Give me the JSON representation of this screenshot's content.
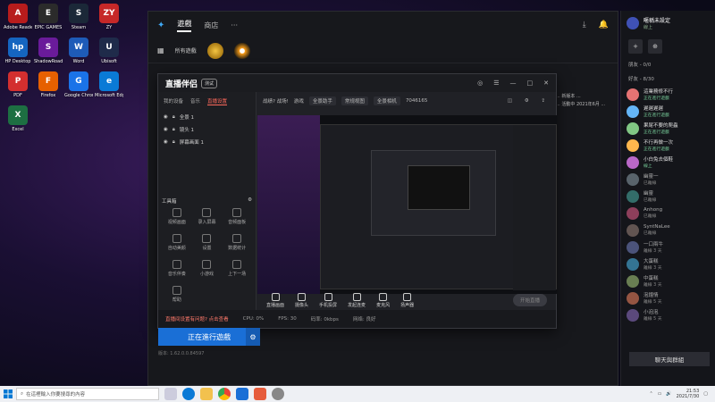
{
  "desktop": {
    "icons": [
      {
        "label": "Adobe Reader",
        "color": "#b71c1c",
        "glyph": "A"
      },
      {
        "label": "EPIC GAMES",
        "color": "#2b2b2b",
        "glyph": "E"
      },
      {
        "label": "Steam",
        "color": "#1b2838",
        "glyph": "S"
      },
      {
        "label": "ZY",
        "color": "#c62828",
        "glyph": "ZY"
      },
      {
        "label": "HP Desktop",
        "color": "#1565c0",
        "glyph": "hp"
      },
      {
        "label": "ShadowRoad",
        "color": "#6a1b9a",
        "glyph": "S"
      },
      {
        "label": "Word",
        "color": "#1e5bb8",
        "glyph": "W"
      },
      {
        "label": "Ubisoft",
        "color": "#1f2b4a",
        "glyph": "U"
      },
      {
        "label": "PDF",
        "color": "#d32f2f",
        "glyph": "P"
      },
      {
        "label": "Firefox",
        "color": "#e66000",
        "glyph": "F"
      },
      {
        "label": "Google Chrome",
        "color": "#1a73e8",
        "glyph": "G"
      },
      {
        "label": "Microsoft Edge",
        "color": "#0a7ad6",
        "glyph": "e"
      },
      {
        "label": "Excel",
        "color": "#1d6f42",
        "glyph": "X"
      }
    ]
  },
  "launcher": {
    "tabs": [
      "遊戲",
      "商店",
      "···"
    ],
    "game_bar_label": "所有遊戲",
    "play_button": "正在進行遊戲",
    "version": "版本: 1.62.0.0.84597"
  },
  "right_text": [
    "... 新版本 ...",
    "... 活動中 2021年6月 ..."
  ],
  "stream": {
    "title": "直播伴侣",
    "version_badge": "测试",
    "header_controls": [
      "◎",
      "☰",
      "—",
      "□",
      "✕"
    ],
    "left_tabs": [
      "我的设备",
      "音乐",
      "直播设置"
    ],
    "scenes": [
      "全景 1",
      "镜头 1",
      "屏幕画面 1"
    ],
    "tools_title": "工具箱",
    "tools": [
      "视频画面",
      "录入屏幕",
      "音频面板",
      "自动美颜",
      "设置",
      "数据统计",
      "音乐伴奏",
      "小游戏",
      "上下一场",
      "帮助"
    ],
    "right_tabs": [
      "战绩? 战场!",
      "游戏",
      "全景助手",
      "常规视图",
      "全景相机",
      "7046165"
    ],
    "bottom_buttons": [
      "直播画面",
      "摄像头",
      "手机投屏",
      "发起连麦",
      "麦克风",
      "扬声器"
    ],
    "start_live": "开始直播",
    "status_warn": "直播间设置有问题? 点击查看",
    "status_items": [
      "CPU: 0%",
      "FPS: 30",
      "码率: 0kbps",
      "网络: 良好"
    ]
  },
  "friends": {
    "me_name": "暱稱未設定",
    "me_status": "線上",
    "groups": [
      "朋友 - 0/0",
      "好友 - 8/30"
    ],
    "list": [
      {
        "name": "這業務修不行",
        "status": "正在進行遊戲",
        "online": true,
        "color": "#e57373"
      },
      {
        "name": "遲遲遲遲",
        "status": "正在進行遊戲",
        "online": true,
        "color": "#64b5f6"
      },
      {
        "name": "果尾不要的爬蟲",
        "status": "正在進行遊戲",
        "online": true,
        "color": "#81c784"
      },
      {
        "name": "不行再做一次",
        "status": "正在進行遊戲",
        "online": true,
        "color": "#ffb74d"
      },
      {
        "name": "小白兔去個鞋",
        "status": "線上",
        "online": true,
        "color": "#ba68c8"
      },
      {
        "name": "幽靈一",
        "status": "已離線",
        "online": false,
        "color": "#90a4ae"
      },
      {
        "name": "幽靈",
        "status": "已離線",
        "online": false,
        "color": "#4db6ac"
      },
      {
        "name": "Anhong",
        "status": "已離線",
        "online": false,
        "color": "#f06292"
      },
      {
        "name": "SyntNaLee",
        "status": "已離線",
        "online": false,
        "color": "#a1887f"
      },
      {
        "name": "一口兩牛",
        "status": "離線 3 天",
        "online": false,
        "color": "#7986cb"
      },
      {
        "name": "大蛋糕",
        "status": "離線 3 天",
        "online": false,
        "color": "#4fc3f7"
      },
      {
        "name": "中蛋糕",
        "status": "離線 3 天",
        "online": false,
        "color": "#aed581"
      },
      {
        "name": "泡鐘情",
        "status": "離線 5 天",
        "online": false,
        "color": "#ff8a65"
      },
      {
        "name": "小泡泡",
        "status": "離線 5 天",
        "online": false,
        "color": "#9575cd"
      }
    ],
    "chat_button": "聊天與群組"
  },
  "taskbar": {
    "search_placeholder": "在這裡輸入你要搜尋的內容",
    "time": "21:53",
    "date": "2021/7/30"
  }
}
